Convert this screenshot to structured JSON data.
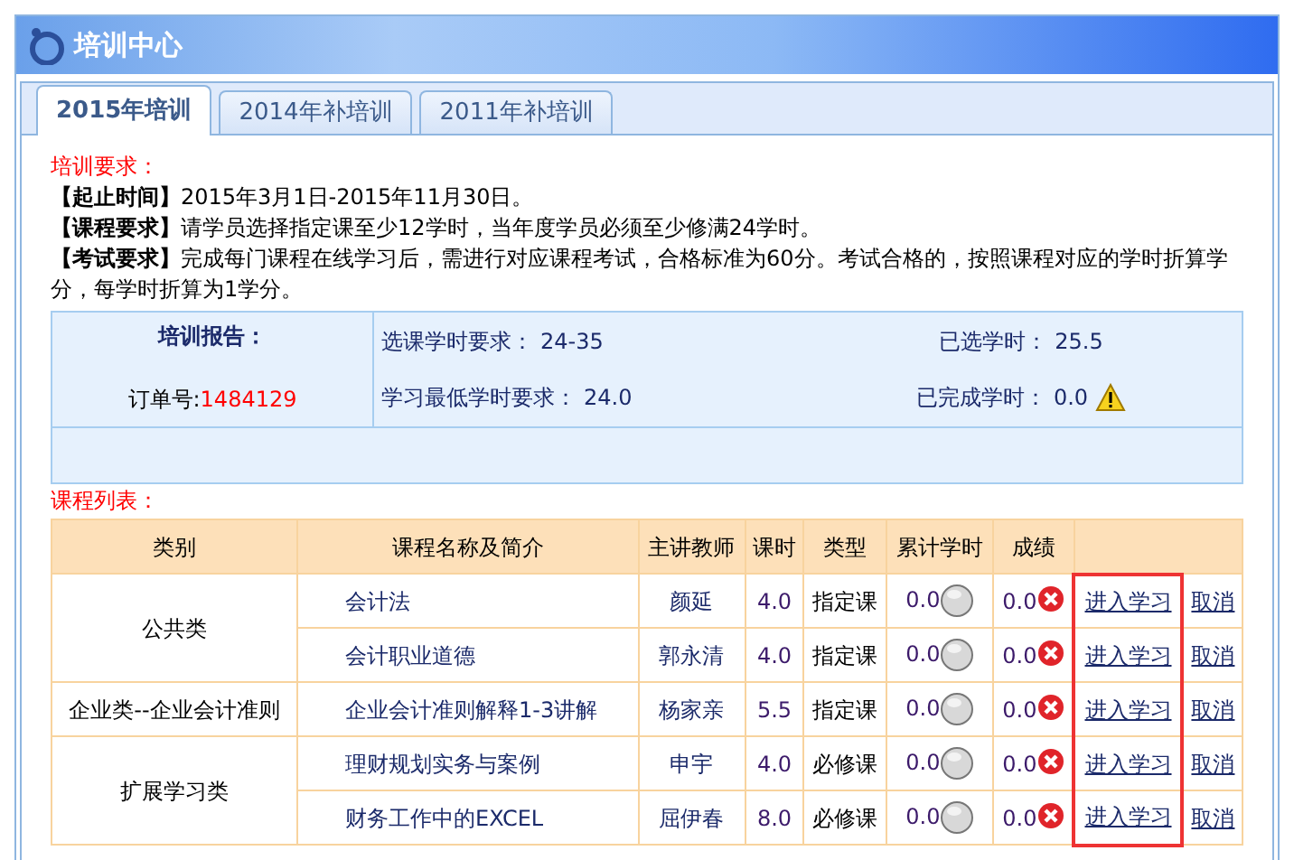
{
  "window": {
    "title": "培训中心"
  },
  "tabs": [
    {
      "label": "2015年培训",
      "selected": true
    },
    {
      "label": "2014年补培训",
      "selected": false
    },
    {
      "label": "2011年补培训",
      "selected": false
    }
  ],
  "requirements": {
    "heading": "培训要求：",
    "items": [
      {
        "label": "【起止时间】",
        "text": "2015年3月1日-2015年11月30日。"
      },
      {
        "label": "【课程要求】",
        "text": "请学员选择指定课至少12学时，当年度学员必须至少修满24学时。"
      },
      {
        "label": "【考试要求】",
        "text": "完成每门课程在线学习后，需进行对应课程考试，合格标准为60分。考试合格的，按照课程对应的学时折算学分，每学时折算为1学分。"
      }
    ]
  },
  "report": {
    "title": "培训报告：",
    "order_label": "订单号:",
    "order_number": "1484129",
    "selected_required_label": "选课学时要求：",
    "selected_required": "24-35",
    "selected_label": "已选学时：",
    "selected": "25.5",
    "min_label": "学习最低学时要求：",
    "min": "24.0",
    "completed_label": "已完成学时：",
    "completed": "0.0",
    "warning": true
  },
  "course_list": {
    "heading": "课程列表：",
    "columns": [
      "类别",
      "课程名称及简介",
      "主讲教师",
      "课时",
      "类型",
      "累计学时",
      "成绩"
    ],
    "groups": [
      {
        "category": "公共类",
        "courses": [
          {
            "name": "会计法",
            "teacher": "颜延",
            "hours": "4.0",
            "type": "指定课",
            "accumulated": "0.0",
            "finished": false,
            "score": "0.0",
            "passed": false,
            "enter": "进入学习",
            "cancel": "取消"
          },
          {
            "name": "会计职业道德",
            "teacher": "郭永清",
            "hours": "4.0",
            "type": "指定课",
            "accumulated": "0.0",
            "finished": false,
            "score": "0.0",
            "passed": false,
            "enter": "进入学习",
            "cancel": "取消"
          }
        ]
      },
      {
        "category": "企业类--企业会计准则",
        "courses": [
          {
            "name": "企业会计准则解释1-3讲解",
            "teacher": "杨家亲",
            "hours": "5.5",
            "type": "指定课",
            "accumulated": "0.0",
            "finished": false,
            "score": "0.0",
            "passed": false,
            "enter": "进入学习",
            "cancel": "取消"
          }
        ]
      },
      {
        "category": "扩展学习类",
        "courses": [
          {
            "name": "理财规划实务与案例",
            "teacher": "申宇",
            "hours": "4.0",
            "type": "必修课",
            "accumulated": "0.0",
            "finished": false,
            "score": "0.0",
            "passed": false,
            "enter": "进入学习",
            "cancel": "取消"
          },
          {
            "name": "财务工作中的EXCEL",
            "teacher": "屈伊春",
            "hours": "8.0",
            "type": "必修课",
            "accumulated": "0.0",
            "finished": false,
            "score": "0.0",
            "passed": false,
            "enter": "进入学习",
            "cancel": "取消"
          }
        ]
      }
    ]
  }
}
